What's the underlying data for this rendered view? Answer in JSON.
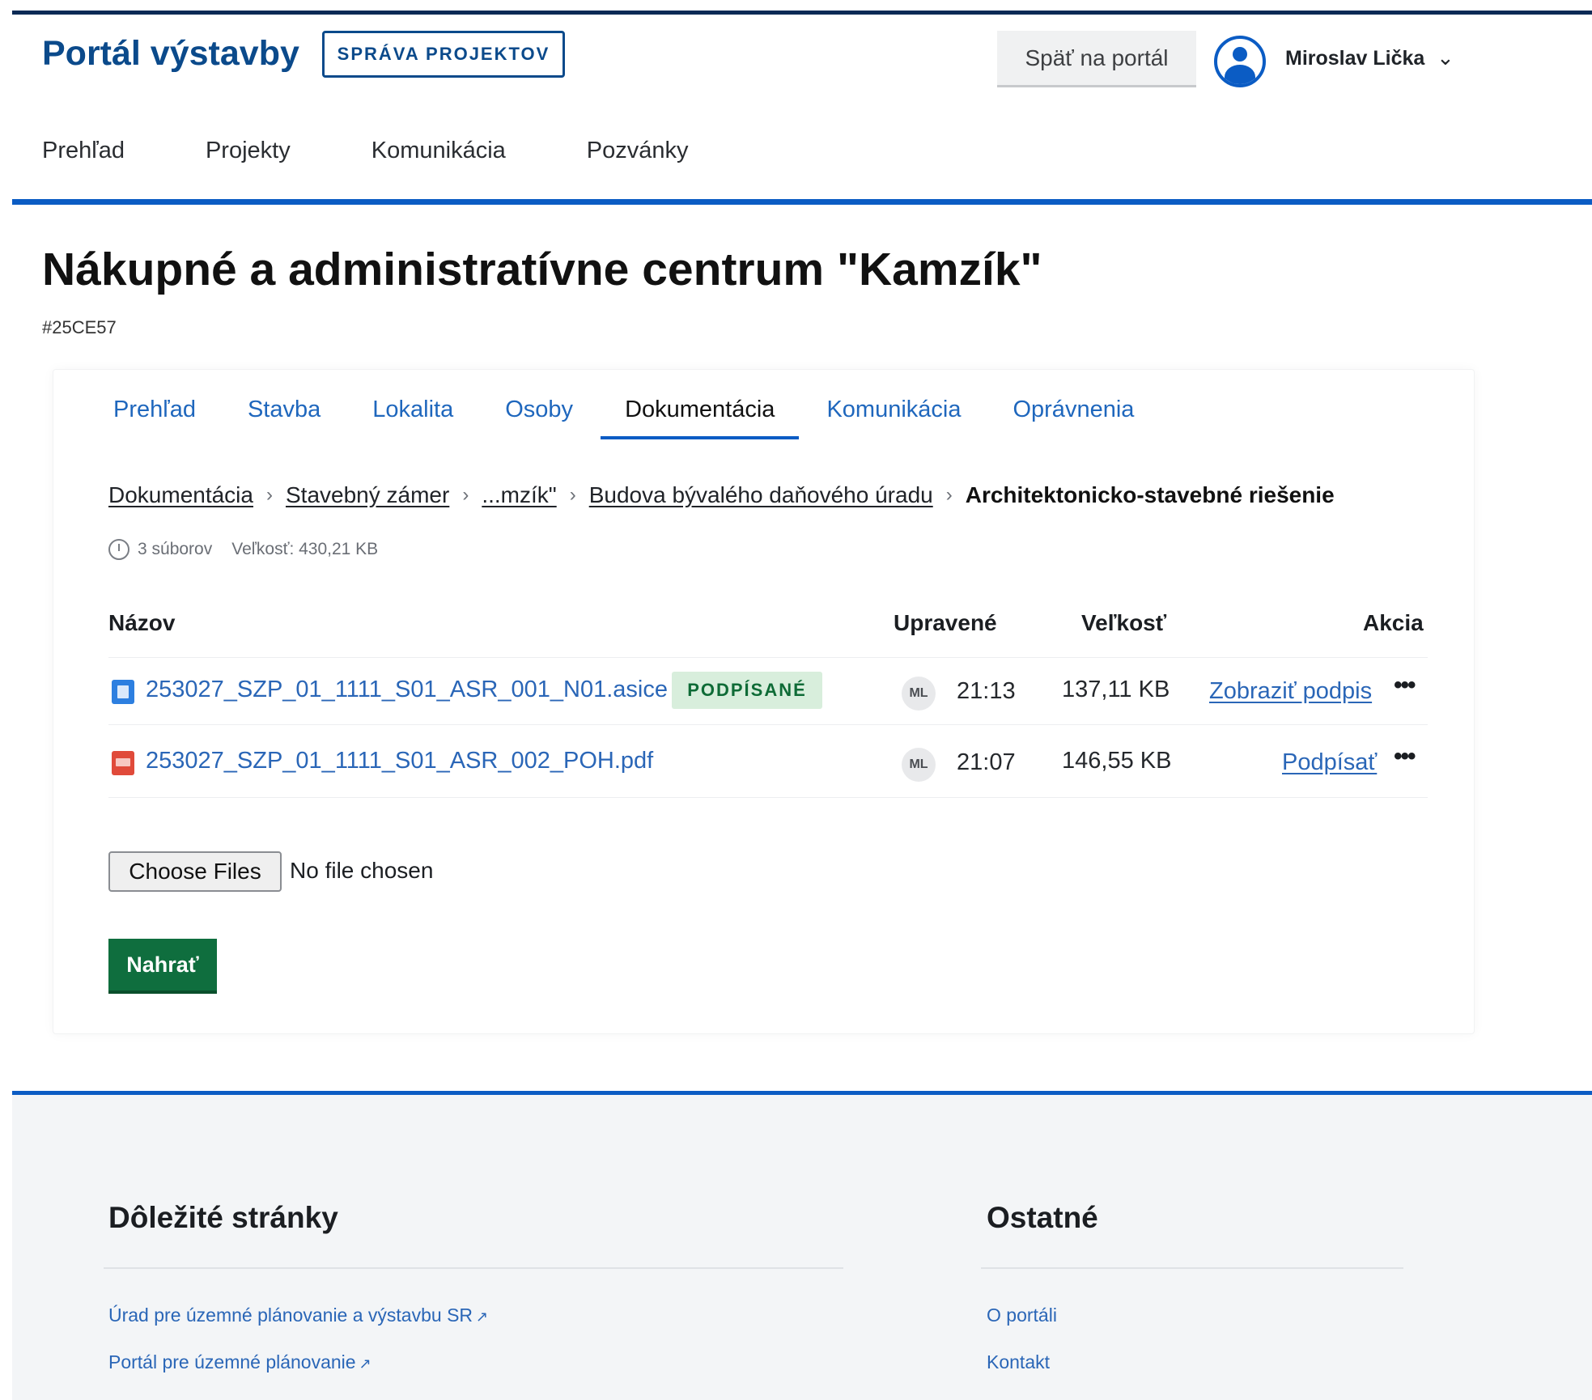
{
  "header": {
    "brand": "Portál výstavby",
    "badge": "SPRÁVA PROJEKTOV",
    "back_button": "Späť na portál",
    "user_name": "Miroslav Lička",
    "user_chevron": "⌄",
    "nav": [
      "Prehľad",
      "Projekty",
      "Komunikácia",
      "Pozvánky"
    ]
  },
  "project": {
    "title": "Nákupné a administratívne centrum \"Kamzík\"",
    "id": "#25CE57"
  },
  "tabs": {
    "items": [
      "Prehľad",
      "Stavba",
      "Lokalita",
      "Osoby",
      "Dokumentácia",
      "Komunikácia",
      "Oprávnenia"
    ],
    "active": "Dokumentácia"
  },
  "breadcrumb": {
    "items": [
      "Dokumentácia",
      "Stavebný zámer",
      "...mzík\"",
      "Budova bývalého daňového úradu"
    ],
    "current": "Architektonicko-stavebné riešenie",
    "separator": "›"
  },
  "folder_meta": {
    "count": "3 súborov",
    "size": "Veľkosť: 430,21 KB"
  },
  "table": {
    "columns": {
      "name": "Názov",
      "modified": "Upravené",
      "size": "Veľkosť",
      "action": "Akcia"
    },
    "rows": [
      {
        "icon": "asice-file-icon",
        "name": "253027_SZP_01_1111_S01_ASR_001_N01.asice",
        "badge": "PODPÍSANÉ",
        "initials": "ML",
        "time": "21:13",
        "size": "137,11 KB",
        "action": "Zobraziť podpis",
        "more": "•••"
      },
      {
        "icon": "pdf-file-icon",
        "name": "253027_SZP_01_1111_S01_ASR_002_POH.pdf",
        "badge": "",
        "initials": "ML",
        "time": "21:07",
        "size": "146,55 KB",
        "action": "Podpísať",
        "more": "•••"
      }
    ]
  },
  "upload": {
    "choose_label": "Choose Files",
    "no_file": "No file chosen",
    "submit_label": "Nahrať"
  },
  "footer": {
    "important_title": "Dôležité stránky",
    "important_links": [
      "Úrad pre územné plánovanie a výstavbu SR",
      "Portál pre územné plánovanie"
    ],
    "other_title": "Ostatné",
    "other_links": [
      "O portáli",
      "Kontakt"
    ],
    "external_icon": "↗"
  },
  "colors": {
    "brand_blue": "#0b4a8b",
    "accent_blue": "#0b5cc4",
    "link_blue": "#2a66b7",
    "success_green": "#0f6e3e",
    "signed_badge_bg": "#d8eedc"
  }
}
